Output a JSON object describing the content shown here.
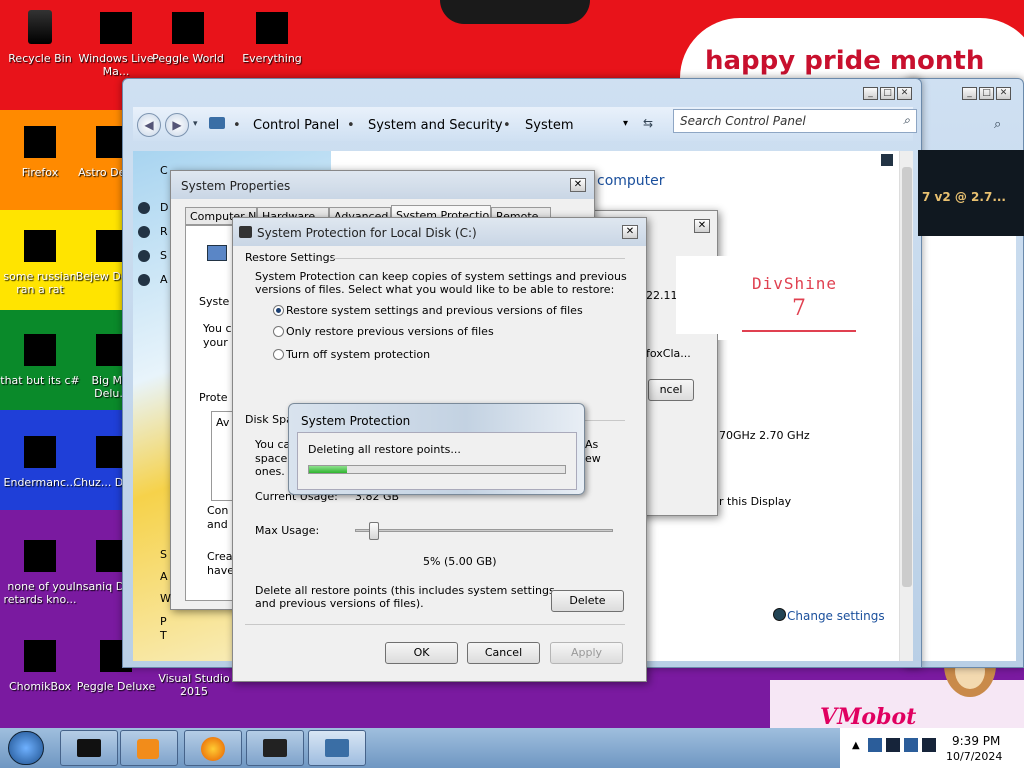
{
  "wallpaper": {
    "banner_text": "happy pride month",
    "bottom_logo": "VMobot"
  },
  "desktop_icons": [
    {
      "label": "Recycle Bin",
      "icon": "recycle-bin-icon"
    },
    {
      "label": "Windows Live Ma...",
      "icon": "windows-live-icon"
    },
    {
      "label": "Peggle World",
      "icon": "peggle-world-icon"
    },
    {
      "label": "Everything",
      "icon": "everything-icon"
    },
    {
      "label": "Firefox",
      "icon": "firefox-icon"
    },
    {
      "label": "Astro Delu...",
      "icon": "astro-icon"
    },
    {
      "label": "some russian ran a rat",
      "icon": "russian-icon"
    },
    {
      "label": "Bejew Delu...",
      "icon": "bejeweled-icon"
    },
    {
      "label": "that but its c#",
      "icon": "csharp-icon"
    },
    {
      "label": "Big M... Delu...",
      "icon": "bigm-icon"
    },
    {
      "label": "Endermanc...",
      "icon": "enderman-icon"
    },
    {
      "label": "Chuz... Delu...",
      "icon": "chuz-icon"
    },
    {
      "label": "none of you retards kno...",
      "icon": "none-icon"
    },
    {
      "label": "Insaniq Delu...",
      "icon": "insaniq-icon"
    },
    {
      "label": "ChomikBox",
      "icon": "chomikbox-icon"
    },
    {
      "label": "Peggle Deluxe",
      "icon": "peggle-deluxe-icon"
    },
    {
      "label": "Visual Studio 2015",
      "icon": "visual-studio-icon"
    }
  ],
  "explorer": {
    "breadcrumb": [
      "Control Panel",
      "System and Security",
      "System"
    ],
    "search_placeholder": "Search Control Panel",
    "content": {
      "heading_fragment": "computer",
      "cpu_fragment": "7 v2 @ 2.7...",
      "file1": "22.11.exe",
      "file2": "foxCla...",
      "divshine": "DivShine",
      "divshine_num": "7",
      "cancel_fragment": "ncel",
      "ghz": "70GHz   2.70 GHz",
      "n_fragment": "n",
      "ishers": "lishers",
      "display": "r this Display",
      "change_settings": "Change settings",
      "left_letters": [
        "C",
        "D",
        "R",
        "S",
        "A",
        "S",
        "A",
        "W",
        "P",
        "T"
      ]
    }
  },
  "system_properties": {
    "title": "System Properties",
    "tabs": [
      "Computer Name",
      "Hardware",
      "Advanced",
      "System Protection",
      "Remote"
    ],
    "fragments": [
      "Syste",
      "You c",
      "your",
      "Prote",
      "Av",
      "Con",
      "and",
      "Crea",
      "have"
    ]
  },
  "protection_dialog": {
    "title": "System Protection for Local Disk (C:)",
    "restore_group": "Restore Settings",
    "restore_desc_line1": "System Protection can keep copies of system settings and previous",
    "restore_desc_line2": "versions of files. Select what you would like to be able to restore:",
    "options": [
      {
        "label": "Restore system settings and previous versions of files",
        "selected": true
      },
      {
        "label": "Only restore previous versions of files",
        "selected": false
      },
      {
        "label": "Turn off system protection",
        "selected": false
      }
    ],
    "disk_group": "Disk Spac",
    "disk_desc_1": "You ca",
    "disk_desc_2": "space f",
    "disk_desc_3": "ones.",
    "disk_right_1": "As",
    "disk_right_2": "ew",
    "current_usage_label": "Current Usage:",
    "current_usage_value": "3.82 GB",
    "max_usage_label": "Max Usage:",
    "max_usage_value": "5% (5.00 GB)",
    "max_usage_fraction": 0.05,
    "delete_text_1": "Delete all restore points (this includes system settings",
    "delete_text_2": "and previous versions of files).",
    "delete_button": "Delete",
    "ok_button": "OK",
    "cancel_button": "Cancel",
    "apply_button": "Apply"
  },
  "progress_popup": {
    "title": "System Protection",
    "message": "Deleting all restore points...",
    "progress_fraction": 0.15
  },
  "taskbar": {
    "time": "9:39 PM",
    "date": "10/7/2024"
  },
  "colors": {
    "accent_link": "#1a4f9c",
    "progress_green": "#2fb52f"
  }
}
